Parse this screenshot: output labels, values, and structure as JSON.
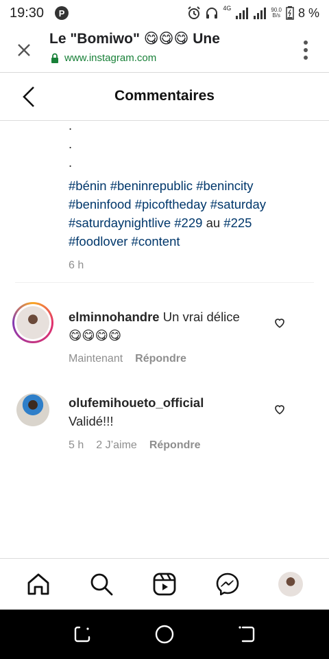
{
  "status_bar": {
    "time": "19:30",
    "notification_badge": "P",
    "network_type": "4G",
    "net_speed_value": "90.0",
    "net_speed_unit": "B/s",
    "battery_percent": "8 %"
  },
  "browser": {
    "title": "Le \"Bomiwo\" 😋😋😋 Une",
    "url": "www.instagram.com"
  },
  "header": {
    "title": "Commentaires"
  },
  "caption": {
    "dots": [
      ".",
      ".",
      "."
    ],
    "tags_line1": [
      "#bénin",
      "#beninrepublic",
      "#benincity"
    ],
    "tags_line2": [
      "#beninfood",
      "#picoftheday",
      "#saturday"
    ],
    "tags_line3a": "#saturdaynightlive",
    "tags_line3b": "#229",
    "tags_line3_mid": "au",
    "tags_line3c": "#225",
    "tags_line4": [
      "#foodlover",
      "#content"
    ],
    "time": "6 h"
  },
  "comments": [
    {
      "username": "elminnohandre",
      "text": "Un vrai délice",
      "emoji": "😋😋😋😋",
      "time": "Maintenant",
      "reply_label": "Répondre"
    },
    {
      "username": "olufemihoueto_official",
      "text": "Validé!!!",
      "time": "5 h",
      "likes": "2 J’aime",
      "reply_label": "Répondre"
    }
  ],
  "nav": {
    "items": [
      "home-icon",
      "search-icon",
      "reels-icon",
      "messenger-icon",
      "profile-avatar"
    ]
  },
  "colors": {
    "hashtag": "#00376b",
    "secondary_text": "#8e8e8e",
    "lock_green": "#188038"
  }
}
